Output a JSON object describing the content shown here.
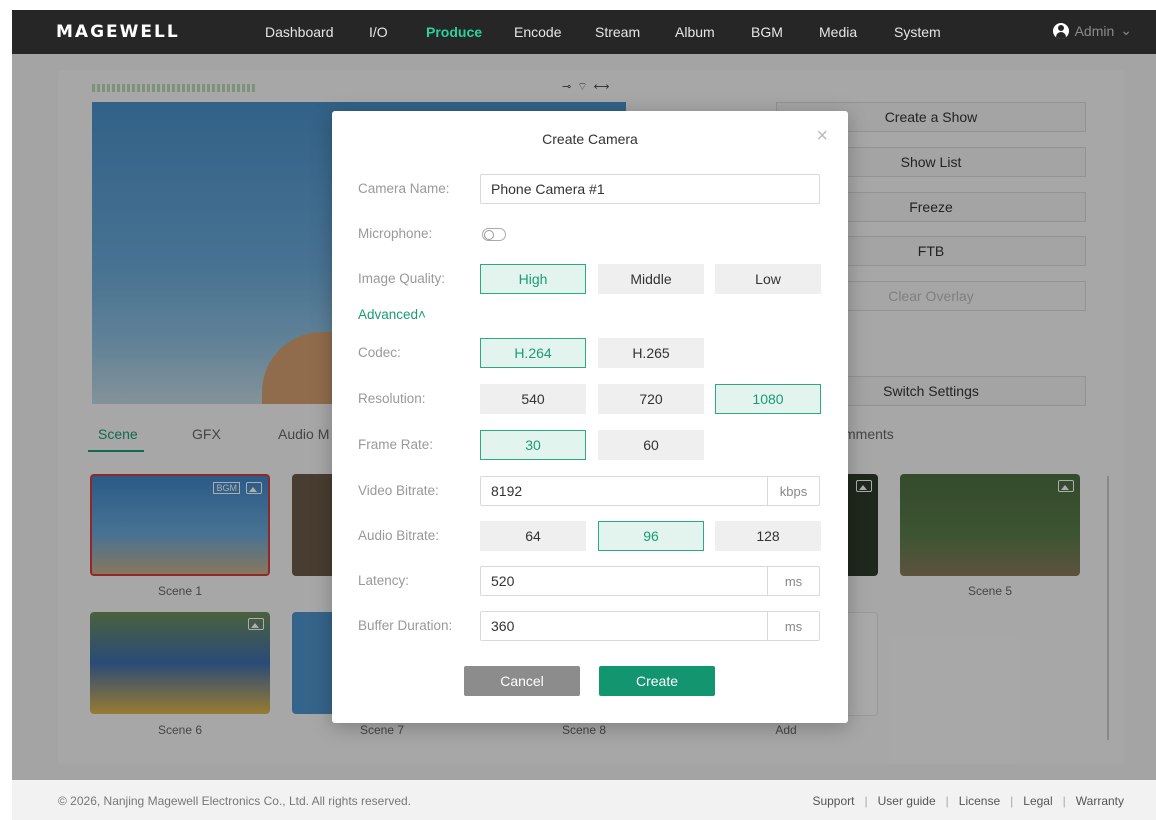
{
  "brand": {
    "logo": "MAGEWELL",
    "accent": "#13956f"
  },
  "nav": {
    "items": [
      "Dashboard",
      "I/O",
      "Produce",
      "Encode",
      "Stream",
      "Album",
      "BGM",
      "Media",
      "System"
    ],
    "active": "Produce",
    "user": "Admin"
  },
  "right_panel": {
    "create_show": "Create a Show",
    "show_list": "Show List",
    "freeze": "Freeze",
    "ftb": "FTB",
    "clear_overlay": "Clear Overlay",
    "switch_settings": "Switch Settings"
  },
  "tabs": {
    "scene": "Scene",
    "gfx": "GFX",
    "audio": "Audio M",
    "comments": "mments"
  },
  "scenes": [
    {
      "label": "Scene 1",
      "badge": "BGM"
    },
    {
      "label": "Scene 5"
    },
    {
      "label": "Scene 6"
    },
    {
      "label": "Scene 7"
    },
    {
      "label": "Scene 8"
    },
    {
      "label": "Add"
    }
  ],
  "footer": {
    "copyright": "© 2026, Nanjing Magewell Electronics Co., Ltd. All rights reserved.",
    "links": [
      "Support",
      "User guide",
      "License",
      "Legal",
      "Warranty"
    ]
  },
  "modal": {
    "title": "Create Camera",
    "camera_name_label": "Camera Name:",
    "camera_name_value": "Phone Camera #1",
    "microphone_label": "Microphone:",
    "microphone_on": false,
    "image_quality_label": "Image Quality:",
    "image_quality_options": [
      "High",
      "Middle",
      "Low"
    ],
    "image_quality_selected": "High",
    "advanced_label": "Advanced",
    "codec_label": "Codec:",
    "codec_options": [
      "H.264",
      "H.265"
    ],
    "codec_selected": "H.264",
    "resolution_label": "Resolution:",
    "resolution_options": [
      "540",
      "720",
      "1080"
    ],
    "resolution_selected": "1080",
    "frame_rate_label": "Frame Rate:",
    "frame_rate_options": [
      "30",
      "60"
    ],
    "frame_rate_selected": "30",
    "video_bitrate_label": "Video Bitrate:",
    "video_bitrate_value": "8192",
    "video_bitrate_unit": "kbps",
    "audio_bitrate_label": "Audio Bitrate:",
    "audio_bitrate_options": [
      "64",
      "96",
      "128"
    ],
    "audio_bitrate_selected": "96",
    "latency_label": "Latency:",
    "latency_value": "520",
    "latency_unit": "ms",
    "buffer_label": "Buffer Duration:",
    "buffer_value": "360",
    "buffer_unit": "ms",
    "cancel": "Cancel",
    "create": "Create"
  }
}
